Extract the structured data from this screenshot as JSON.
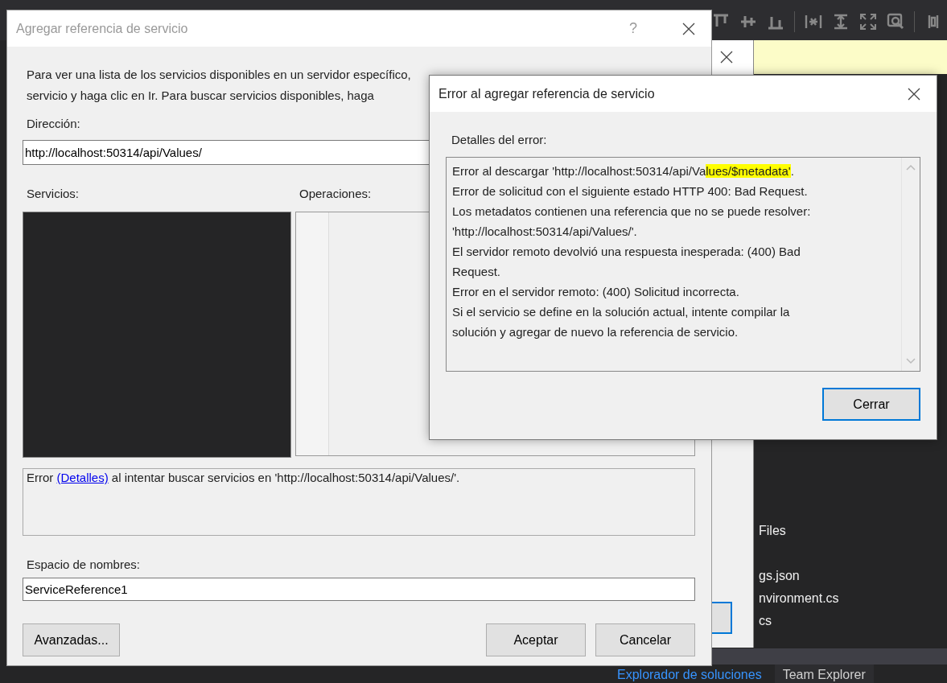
{
  "ide": {
    "solution_tree": [
      "Files",
      "gs.json",
      "nvironment.cs",
      "cs"
    ],
    "bottom_tabs": [
      {
        "label": "Explorador de soluciones",
        "selected": true
      },
      {
        "label": "Team Explorer",
        "selected": false
      }
    ]
  },
  "main_dialog": {
    "title": "Agregar referencia de servicio",
    "help": "?",
    "description": [
      "Para ver una lista de los servicios disponibles en un servidor específico,",
      "servicio y haga clic en Ir. Para buscar servicios disponibles, haga"
    ],
    "address_label": "Dirección:",
    "address_value": "http://localhost:50314/api/Values/",
    "services_label": "Servicios:",
    "operations_label": "Operaciones:",
    "status": {
      "before": "Error ",
      "link": "(Detalles)",
      "after": " al intentar buscar servicios en 'http://localhost:50314/api/Values/'."
    },
    "namespace_label": "Espacio de nombres:",
    "namespace_value": "ServiceReference1",
    "buttons": [
      {
        "label": "Avanzadas...",
        "kind": "left"
      },
      {
        "label": "Aceptar",
        "kind": "right"
      },
      {
        "label": "Cancelar",
        "kind": "right"
      }
    ]
  },
  "error_dialog": {
    "title": "Error al agregar referencia de servicio",
    "details_label": "Detalles del error:",
    "lines": [
      {
        "segments": [
          {
            "text": "Error al descargar 'http://localhost:50314/api/Va",
            "highlighted": false
          },
          {
            "text": "lues/$metadata'",
            "highlighted": true
          },
          {
            "text": ".",
            "highlighted": false
          }
        ]
      },
      {
        "segments": [
          {
            "text": "Error de solicitud con el siguiente estado HTTP 400: Bad Request.",
            "highlighted": false
          }
        ]
      },
      {
        "segments": [
          {
            "text": "Los metadatos contienen una referencia que no se puede resolver:",
            "highlighted": false
          }
        ]
      },
      {
        "segments": [
          {
            "text": "'http://localhost:50314/api/Values/'.",
            "highlighted": false
          }
        ]
      },
      {
        "segments": [
          {
            "text": "El servidor remoto devolvió una respuesta inesperada: (400) Bad",
            "highlighted": false
          }
        ]
      },
      {
        "segments": [
          {
            "text": "Request.",
            "highlighted": false
          }
        ]
      },
      {
        "segments": [
          {
            "text": "Error en el servidor remoto: (400) Solicitud incorrecta.",
            "highlighted": false
          }
        ]
      },
      {
        "segments": [
          {
            "text": "Si el servicio se define en la solución actual, intente compilar la",
            "highlighted": false
          }
        ]
      },
      {
        "segments": [
          {
            "text": "solución y agregar de nuevo la referencia de servicio.",
            "highlighted": false
          }
        ]
      }
    ],
    "button": {
      "label": "Cerrar",
      "focused": true
    }
  }
}
